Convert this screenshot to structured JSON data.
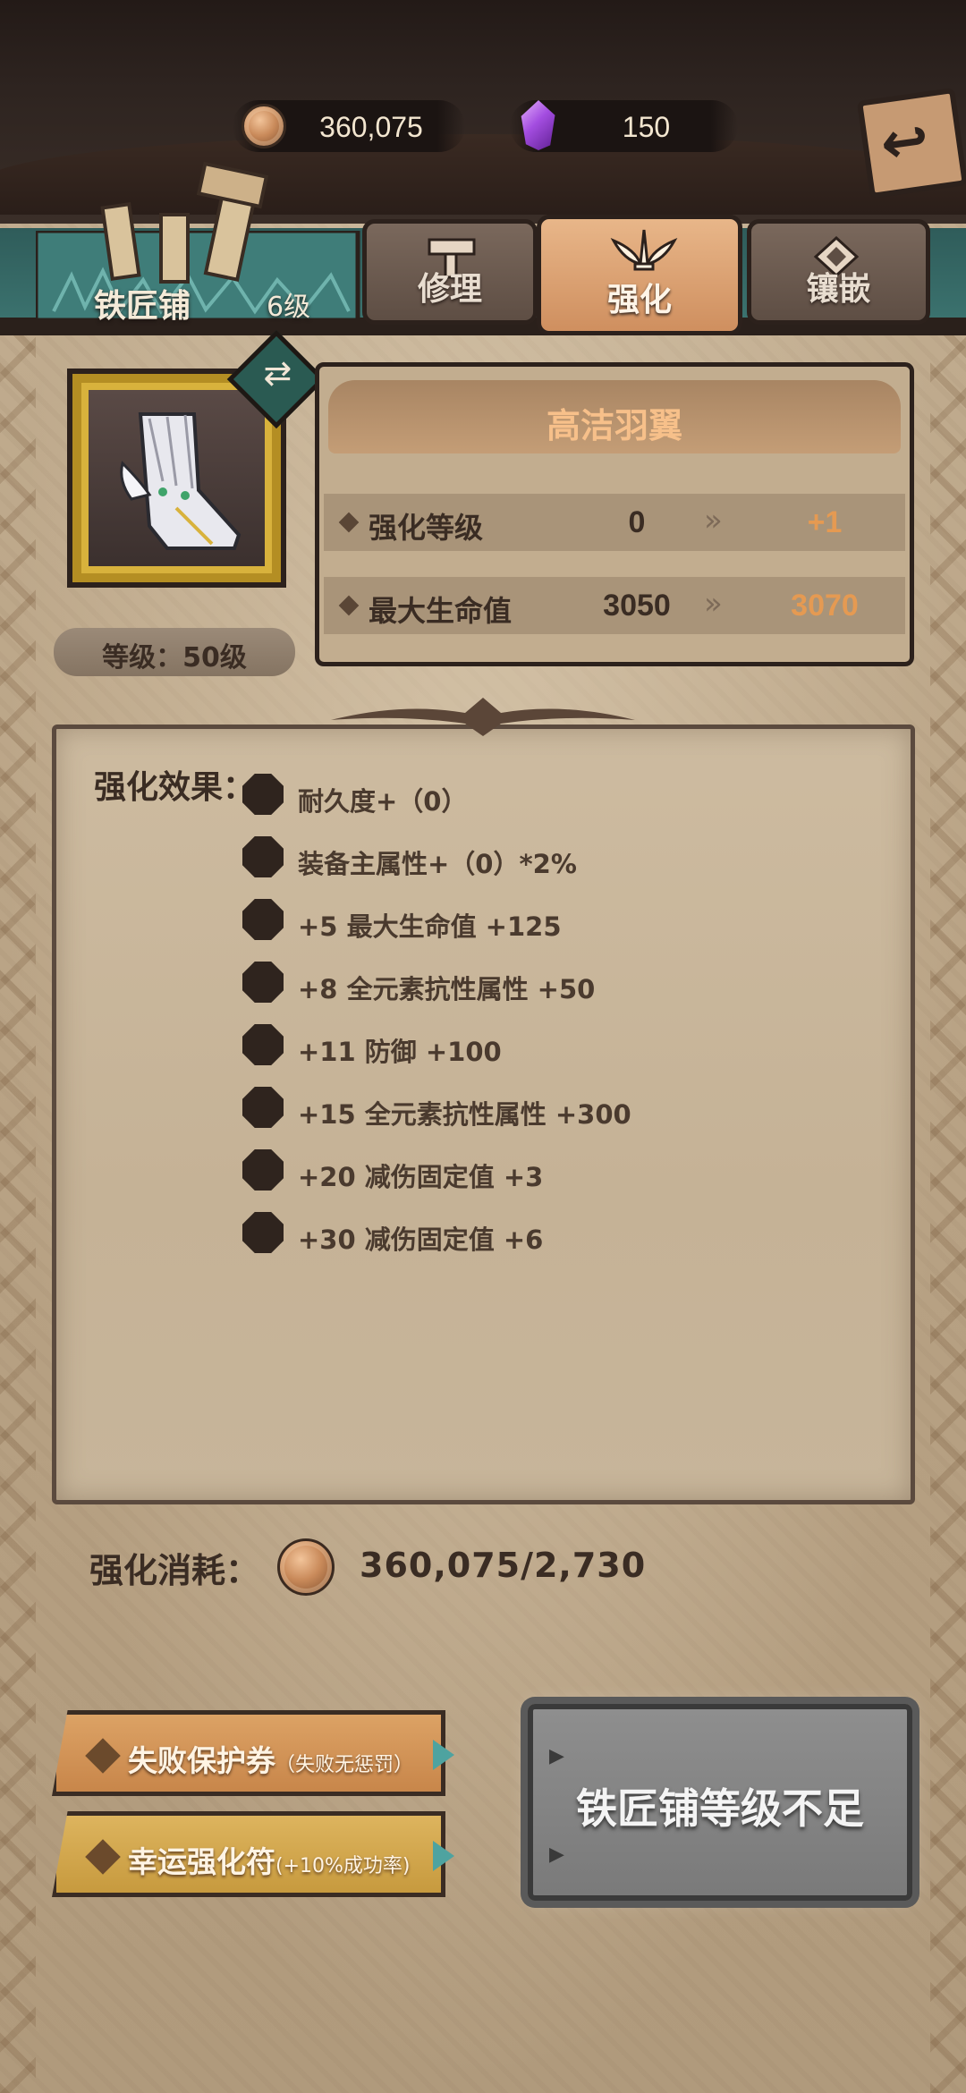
{
  "currency": {
    "coins": "360,075",
    "gems": "150"
  },
  "shop": {
    "name": "铁匠铺",
    "level": "6级"
  },
  "tabs": [
    {
      "label": "修理",
      "active": false
    },
    {
      "label": "强化",
      "active": true
    },
    {
      "label": "镶嵌",
      "active": false
    }
  ],
  "item": {
    "name": "高洁羽翼",
    "level_label": "等级：50级"
  },
  "stats": [
    {
      "name": "强化等级",
      "current": "0",
      "next": "+1"
    },
    {
      "name": "最大生命值",
      "current": "3050",
      "next": "3070"
    }
  ],
  "effects": {
    "title": "强化效果：",
    "items": [
      "耐久度+（0）",
      "装备主属性+（0）*2%",
      "+5  最大生命值 +125",
      "+8  全元素抗性属性 +50",
      "+11  防御 +100",
      "+15  全元素抗性属性 +300",
      "+20  减伤固定值 +3",
      "+30  减伤固定值 +6"
    ]
  },
  "cost": {
    "label": "强化消耗：",
    "value": "360,075/2,730"
  },
  "buttons": {
    "protect_main": "失败保护券",
    "protect_sub": "（失败无惩罚）",
    "luck_main": "幸运强化符",
    "luck_sub": "(+10%成功率)",
    "action": "铁匠铺等级不足"
  },
  "icons": {
    "coin": "coin-icon",
    "gem": "gem-icon",
    "back": "back-arrow-icon",
    "swap": "swap-icon"
  },
  "colors": {
    "accent_orange": "#e59a52",
    "title_orange": "#f7c08a",
    "disabled_gray": "#8e8e8e"
  }
}
